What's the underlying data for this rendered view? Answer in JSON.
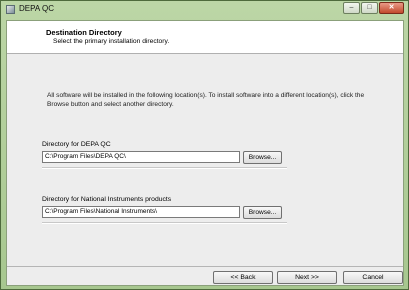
{
  "window": {
    "title": "DEPA QC"
  },
  "header": {
    "title": "Destination Directory",
    "subtitle": "Select the primary installation directory."
  },
  "info_text": "All software will be installed in the following location(s). To install software into a different location(s), click the Browse button and select another directory.",
  "directories": [
    {
      "label": "Directory for DEPA QC",
      "path": "C:\\Program Files\\DEPA QC\\",
      "browse_label": "Browse..."
    },
    {
      "label": "Directory for National Instruments products",
      "path": "C:\\Program Files\\National Instruments\\",
      "browse_label": "Browse..."
    }
  ],
  "buttons": {
    "back": "<< Back",
    "next": "Next >>",
    "cancel": "Cancel"
  }
}
